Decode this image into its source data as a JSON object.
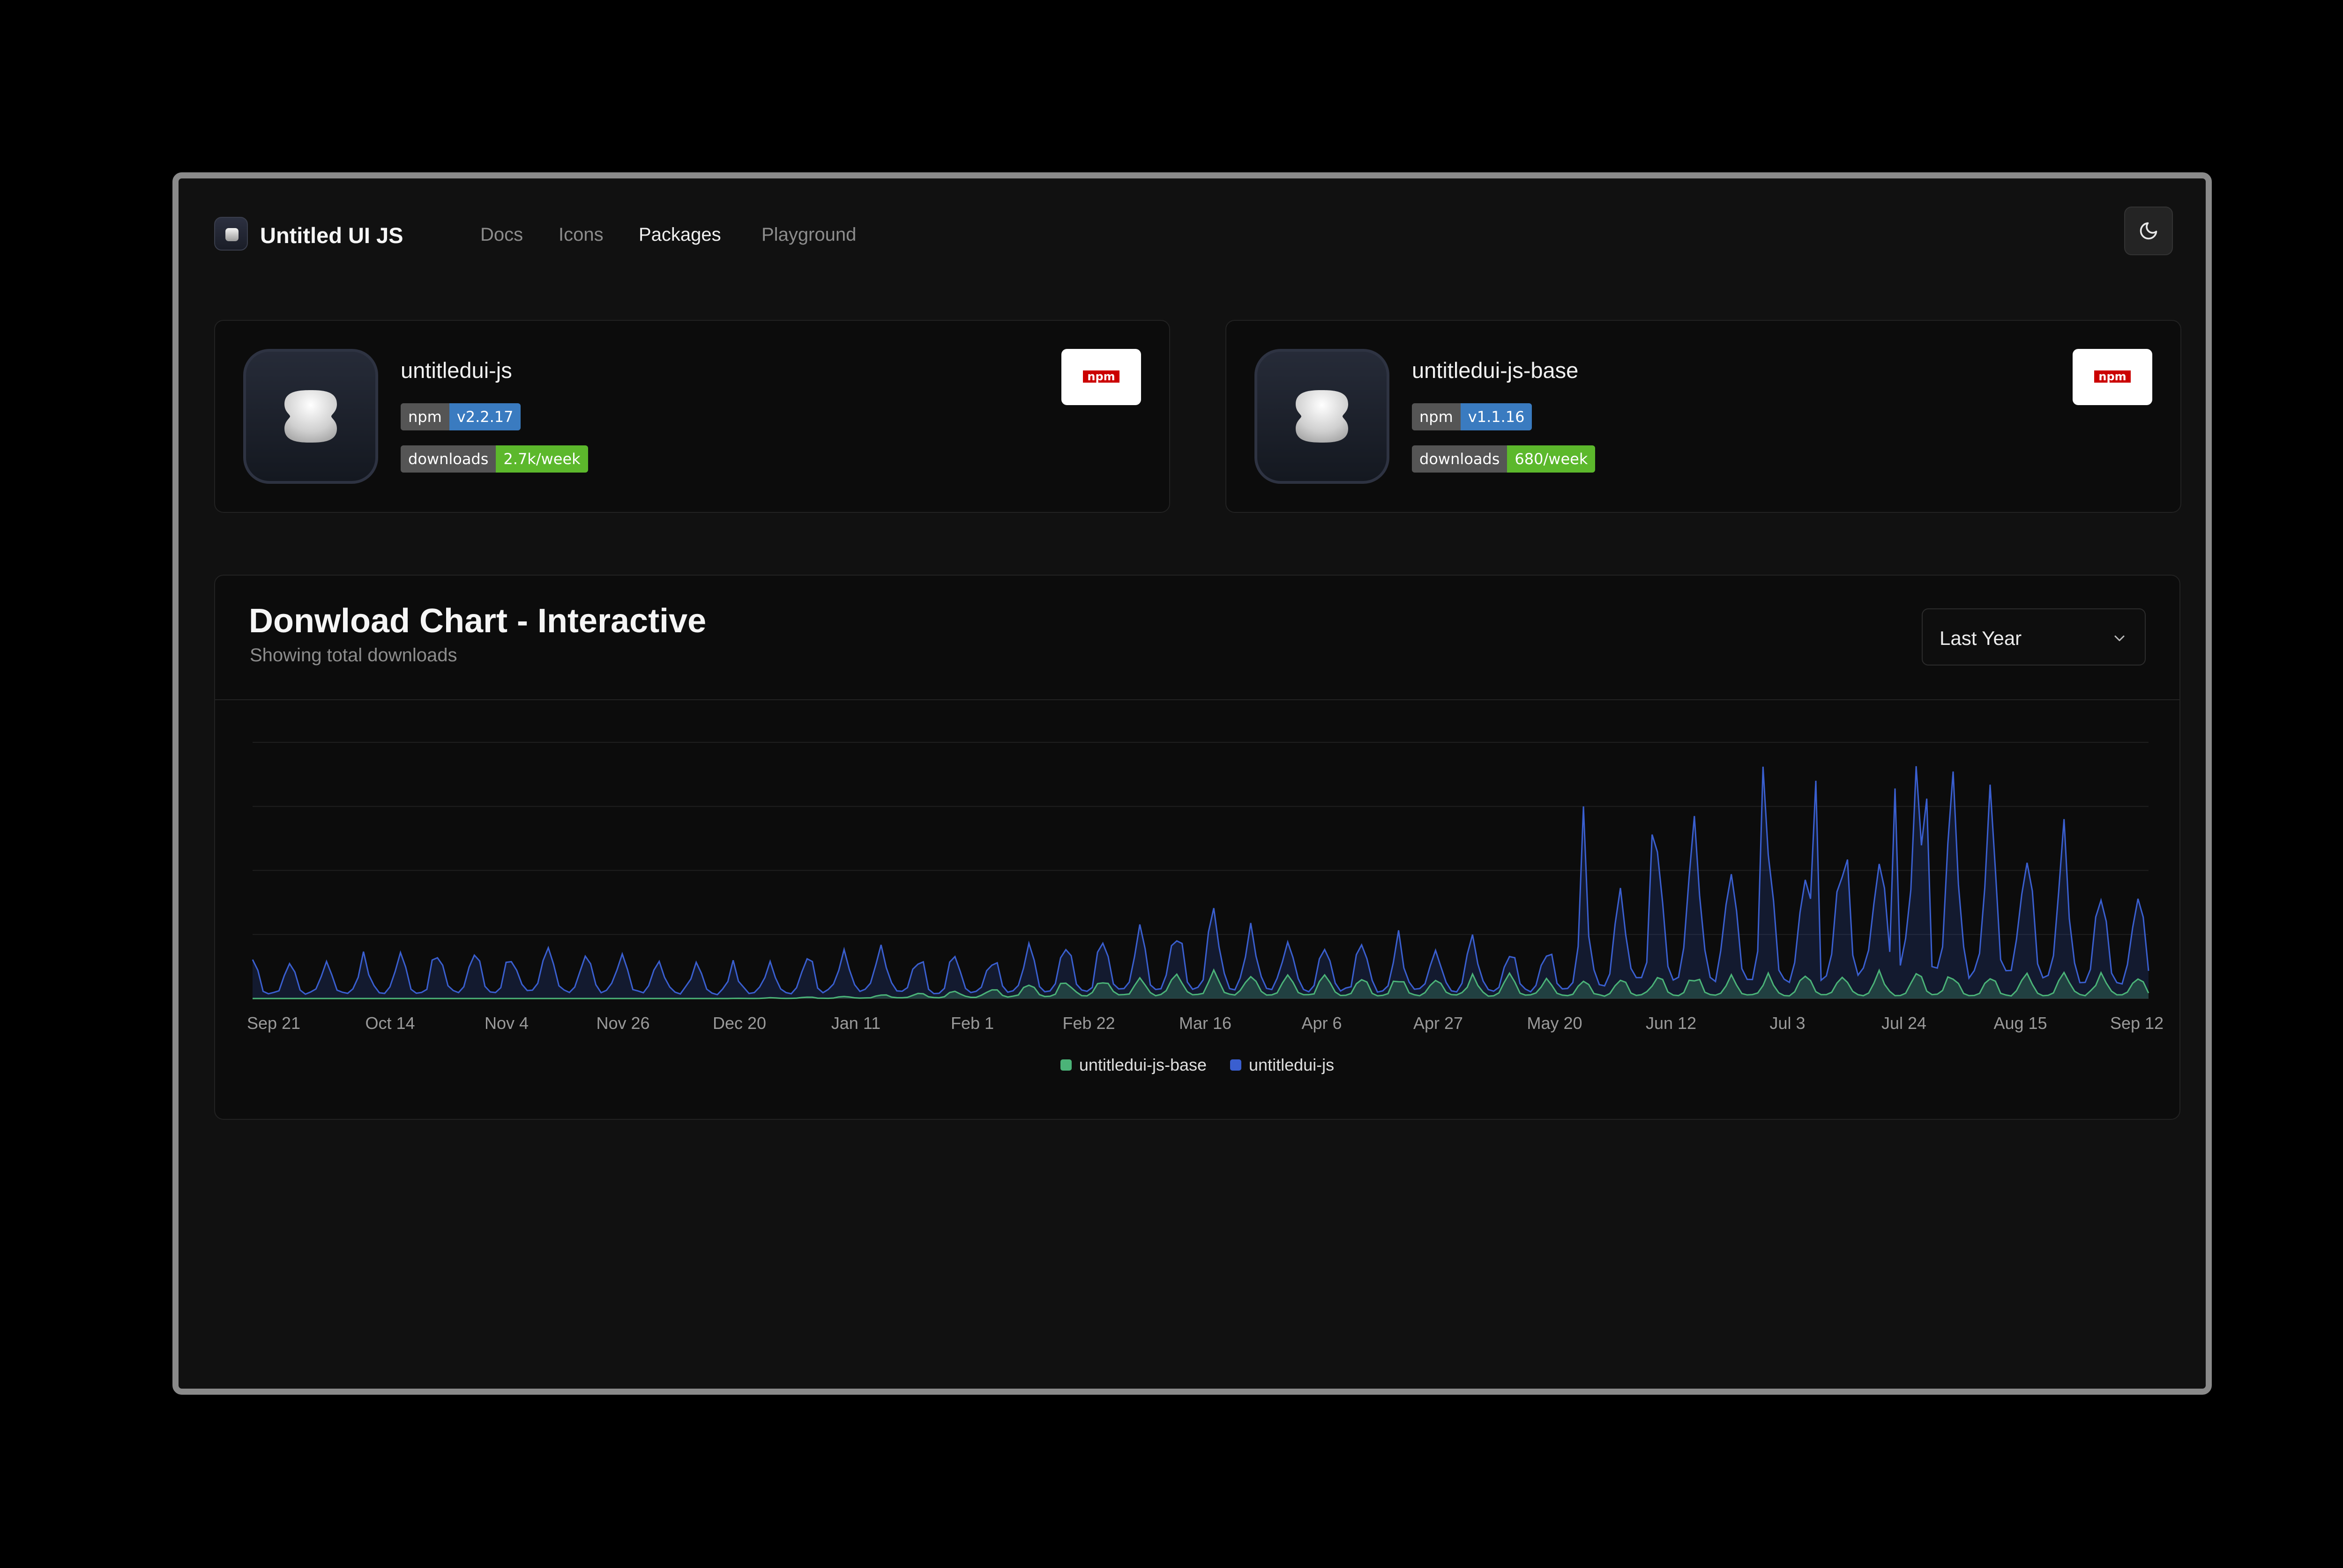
{
  "nav": {
    "brand": "Untitled UI JS",
    "links": [
      {
        "label": "Docs",
        "active": false
      },
      {
        "label": "Icons",
        "active": false
      },
      {
        "label": "Packages",
        "active": true
      },
      {
        "label": "Playground",
        "active": false
      }
    ],
    "theme_icon": "moon-icon"
  },
  "packages": [
    {
      "name": "untitledui-js",
      "version_key": "npm",
      "version": "v2.2.17",
      "downloads_key": "downloads",
      "downloads": "2.7k/week",
      "npm_logo": "npm"
    },
    {
      "name": "untitledui-js-base",
      "version_key": "npm",
      "version": "v1.1.16",
      "downloads_key": "downloads",
      "downloads": "680/week",
      "npm_logo": "npm"
    }
  ],
  "chart": {
    "title": "Donwload Chart - Interactive",
    "subtitle": "Showing total downloads",
    "range_select": "Last Year"
  },
  "colors": {
    "base_series": "#4bb378",
    "js_series": "#3a5fd0",
    "npm_red": "#cb0000"
  },
  "chart_data": {
    "type": "area",
    "title": "Donwload Chart - Interactive",
    "subtitle": "Showing total downloads",
    "x_tick_labels": [
      "Sep 21",
      "Oct 14",
      "Nov 4",
      "Nov 26",
      "Dec 20",
      "Jan 11",
      "Feb 1",
      "Feb 22",
      "Mar 16",
      "Apr 6",
      "Apr 27",
      "May 20",
      "Jun 12",
      "Jul 3",
      "Jul 24",
      "Aug 15",
      "Sep 12"
    ],
    "grid": true,
    "y_axis_visible": false,
    "ylim": [
      0,
      4000
    ],
    "legend_position": "bottom-center",
    "stacked": false,
    "series": [
      {
        "name": "untitledui-js-base",
        "color": "#4bb378",
        "daily_peaks_by_tick": [
          0,
          0,
          0,
          0,
          0,
          40,
          150,
          380,
          460,
          420,
          400,
          380,
          420,
          400,
          480,
          430,
          420
        ]
      },
      {
        "name": "untitledui-js",
        "color": "#3a5fd0",
        "daily_peaks_by_tick": [
          620,
          760,
          890,
          870,
          560,
          1010,
          760,
          960,
          1470,
          1100,
          1020,
          1000,
          3000,
          2560,
          3620,
          3280,
          1800
        ]
      }
    ]
  }
}
